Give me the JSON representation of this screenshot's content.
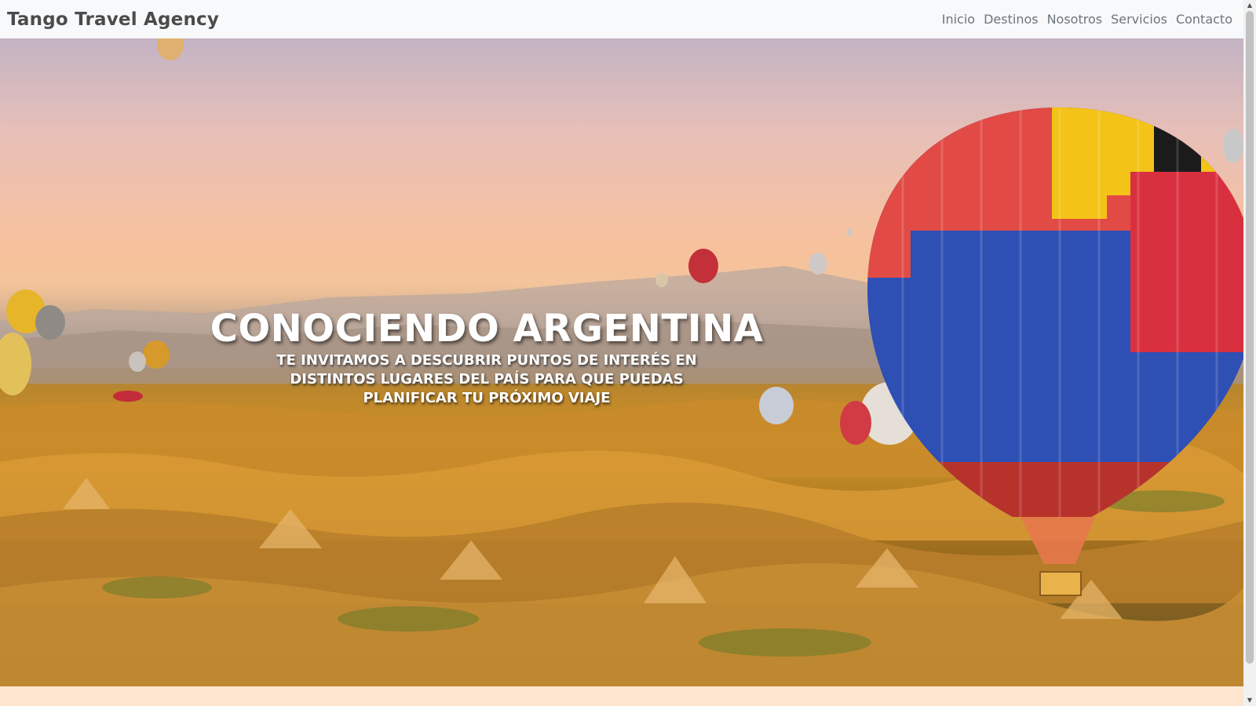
{
  "navbar": {
    "brand": "Tango Travel Agency",
    "links": [
      "Inicio",
      "Destinos",
      "Nosotros",
      "Servicios",
      "Contacto"
    ]
  },
  "hero": {
    "title": "CONOCIENDO ARGENTINA",
    "subtitle": "TE INVITAMOS A DESCUBRIR PUNTOS DE INTERÉS EN DISTINTOS LUGARES DEL PAÍS PARA QUE PUEDAS PLANIFICAR TU PRÓXIMO VIAJE"
  },
  "colors": {
    "navbar_bg": "#f8f9fa",
    "brand_text": "#4b4b4b",
    "nav_text": "#6c757d",
    "page_bg": "#fde5cf"
  },
  "icons": {
    "scroll_up": "arrow-up-icon",
    "scroll_down": "arrow-down-icon"
  }
}
